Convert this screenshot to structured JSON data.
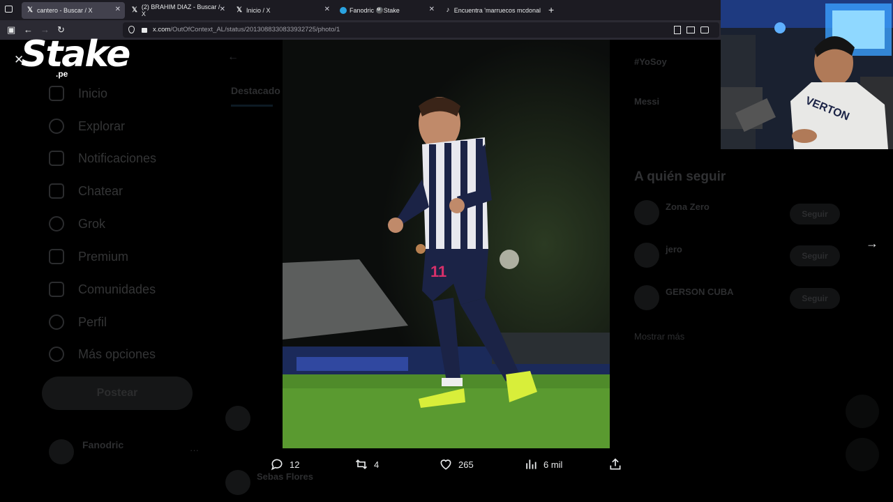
{
  "browser": {
    "tabs": [
      {
        "label": "cantero - Buscar / X",
        "icon": "x-logo-icon",
        "active": true
      },
      {
        "label": "(2) BRAHIM DIAZ - Buscar / X",
        "icon": "x-logo-icon",
        "active": false
      },
      {
        "label": "Inicio / X",
        "icon": "x-logo-icon",
        "active": false
      },
      {
        "label": "Fanodric 🎱Stake",
        "icon": "telegram-icon",
        "active": false
      },
      {
        "label": "Encuentra 'marruecos mcdonal",
        "icon": "tiktok-icon",
        "active": false
      }
    ],
    "url_host": "x.com",
    "url_path": "/OutOfContext_AL/status/2013088330833932725/photo/1"
  },
  "overlay": {
    "logo_text": "Stake",
    "logo_sub": ".pe"
  },
  "sidebar": {
    "items": [
      {
        "label": "Inicio",
        "icon": "home-icon"
      },
      {
        "label": "Explorar",
        "icon": "search-icon"
      },
      {
        "label": "Notificaciones",
        "icon": "bell-icon"
      },
      {
        "label": "Chatear",
        "icon": "mail-icon"
      },
      {
        "label": "Grok",
        "icon": "grok-icon"
      },
      {
        "label": "Premium",
        "icon": "x-logo-icon"
      },
      {
        "label": "Comunidades",
        "icon": "people-icon"
      },
      {
        "label": "Perfil",
        "icon": "person-icon"
      },
      {
        "label": "Más opciones",
        "icon": "more-icon"
      }
    ],
    "post_button": "Postear",
    "account_name": "Fanodric"
  },
  "timeline": {
    "tab_label": "Destacado",
    "reply_author": "Sebas Flores"
  },
  "right_panel": {
    "hashtag": "#YoSoy",
    "trend": "Messi",
    "who_to_follow_title": "A quién seguir",
    "suggestions": [
      {
        "name": "Zona Zero",
        "button": "Seguir"
      },
      {
        "name": "jero",
        "button": "Seguir"
      },
      {
        "name": "GERSON CUBA",
        "button": "Seguir"
      }
    ],
    "more_label": "Mostrar más"
  },
  "post_actions": {
    "replies": "12",
    "reposts": "4",
    "likes": "265",
    "views": "6 mil"
  },
  "webcam": {
    "shirt_text": "VERTON"
  }
}
